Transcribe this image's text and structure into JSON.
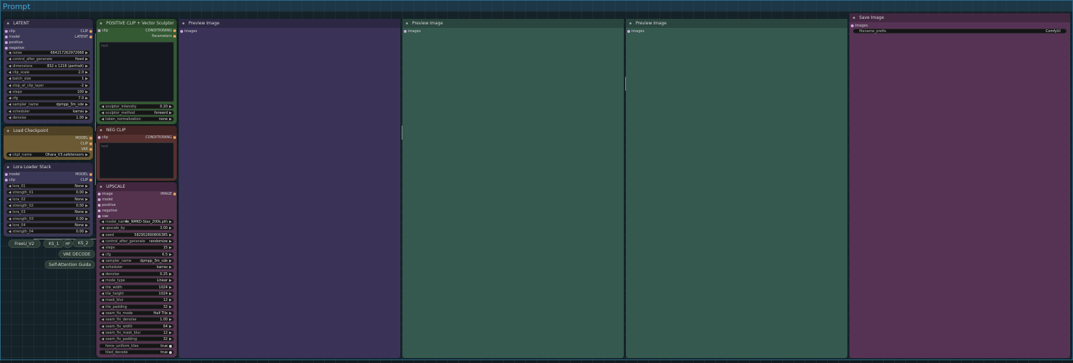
{
  "group": {
    "title": "Prompt"
  },
  "latent": {
    "title": "LATENT",
    "inputs": [
      "clip",
      "model",
      "positive",
      "negative"
    ],
    "outputs": [
      "CLIP",
      "LATENT"
    ],
    "widgets": [
      {
        "label": "noise",
        "value": "664217262972668"
      },
      {
        "label": "control_after_generate",
        "value": "fixed"
      },
      {
        "label": "dimensions",
        "value": "832 x 1216  (portrait)"
      },
      {
        "label": "clip_scale",
        "value": "2.0"
      },
      {
        "label": "batch_size",
        "value": "1"
      },
      {
        "label": "stop_at_clip_layer",
        "value": "-2"
      },
      {
        "label": "steps",
        "value": "100"
      },
      {
        "label": "cfg",
        "value": "7.0"
      },
      {
        "label": "sampler_name",
        "value": "dpmpp_3m_sde"
      },
      {
        "label": "scheduler",
        "value": "karras"
      },
      {
        "label": "denoise",
        "value": "1.00"
      }
    ]
  },
  "checkpoint": {
    "title": "Load Checkpoint",
    "outputs": [
      "MODEL",
      "CLIP",
      "VAE"
    ],
    "widgets": [
      {
        "label": "ckpt_name",
        "value": "Ohara_V3.safetensors"
      }
    ]
  },
  "lora": {
    "title": "Lora Loader Stack",
    "inputs": [
      "model",
      "clip"
    ],
    "outputs": [
      "MODEL",
      "CLIP"
    ],
    "widgets": [
      {
        "label": "lora_01",
        "value": "None"
      },
      {
        "label": "strength_01",
        "value": "0.00"
      },
      {
        "label": "lora_02",
        "value": "None"
      },
      {
        "label": "strength_02",
        "value": "0.00"
      },
      {
        "label": "lora_03",
        "value": "None"
      },
      {
        "label": "strength_03",
        "value": "0.00"
      },
      {
        "label": "lora_04",
        "value": "None"
      },
      {
        "label": "strength_04",
        "value": "0.00"
      }
    ]
  },
  "pills": [
    "FreeU_V2",
    "KS_1",
    "HF",
    "KS_2",
    "VAE DECODE",
    "Self-Attention Guida"
  ],
  "positive": {
    "title": "POSITIVE CLIP + Vector Sculptor",
    "inputs": [
      "clip"
    ],
    "outputs": [
      "CONDITIONING",
      "Parameters"
    ],
    "placeholder": "text",
    "widgets": [
      {
        "label": "sculptor_intensity",
        "value": "0.20"
      },
      {
        "label": "sculptor_method",
        "value": "forward"
      },
      {
        "label": "token_normalization",
        "value": "none"
      }
    ]
  },
  "neg": {
    "title": "NEG CLIP",
    "inputs": [
      "clip"
    ],
    "outputs": [
      "CONDITIONING"
    ],
    "placeholder": "text"
  },
  "upscale": {
    "title": "UPSCALE",
    "inputs": [
      "image",
      "model",
      "positive",
      "negative",
      "vae"
    ],
    "outputs": [
      "IMAGE"
    ],
    "widgets": [
      {
        "label": "model_name",
        "value": "4x_NMKD-Siax_200k.pth"
      },
      {
        "label": "upscale_by",
        "value": "3.00"
      },
      {
        "label": "seed",
        "value": "582952890806385"
      },
      {
        "label": "control_after_generate",
        "value": "randomize"
      },
      {
        "label": "steps",
        "value": "15"
      },
      {
        "label": "cfg",
        "value": "6.5"
      },
      {
        "label": "sampler_name",
        "value": "dpmpp_3m_sde"
      },
      {
        "label": "scheduler",
        "value": "karras"
      },
      {
        "label": "denoise",
        "value": "0.25"
      },
      {
        "label": "mode_type",
        "value": "Linear"
      },
      {
        "label": "tile_width",
        "value": "1024"
      },
      {
        "label": "tile_height",
        "value": "1024"
      },
      {
        "label": "mask_blur",
        "value": "12"
      },
      {
        "label": "tile_padding",
        "value": "32"
      },
      {
        "label": "seam_fix_mode",
        "value": "Half Tile"
      },
      {
        "label": "seam_fix_denoise",
        "value": "1.00"
      },
      {
        "label": "seam_fix_width",
        "value": "64"
      },
      {
        "label": "seam_fix_mask_blur",
        "value": "12"
      },
      {
        "label": "seam_fix_padding",
        "value": "32"
      }
    ],
    "toggles": [
      {
        "label": "force_uniform_tiles",
        "value": "true"
      },
      {
        "label": "tiled_decode",
        "value": "true"
      }
    ]
  },
  "previews": [
    {
      "title": "Preview Image",
      "input": "images",
      "color": "#3a3357"
    },
    {
      "title": "Preview Image",
      "input": "images",
      "color": "#35584f"
    },
    {
      "title": "Preview Image",
      "input": "images",
      "color": "#35584f"
    }
  ],
  "save": {
    "title": "Save Image",
    "input": "images",
    "widget": {
      "label": "filename_prefix",
      "value": "ComfyUI"
    },
    "color": "#563355"
  }
}
